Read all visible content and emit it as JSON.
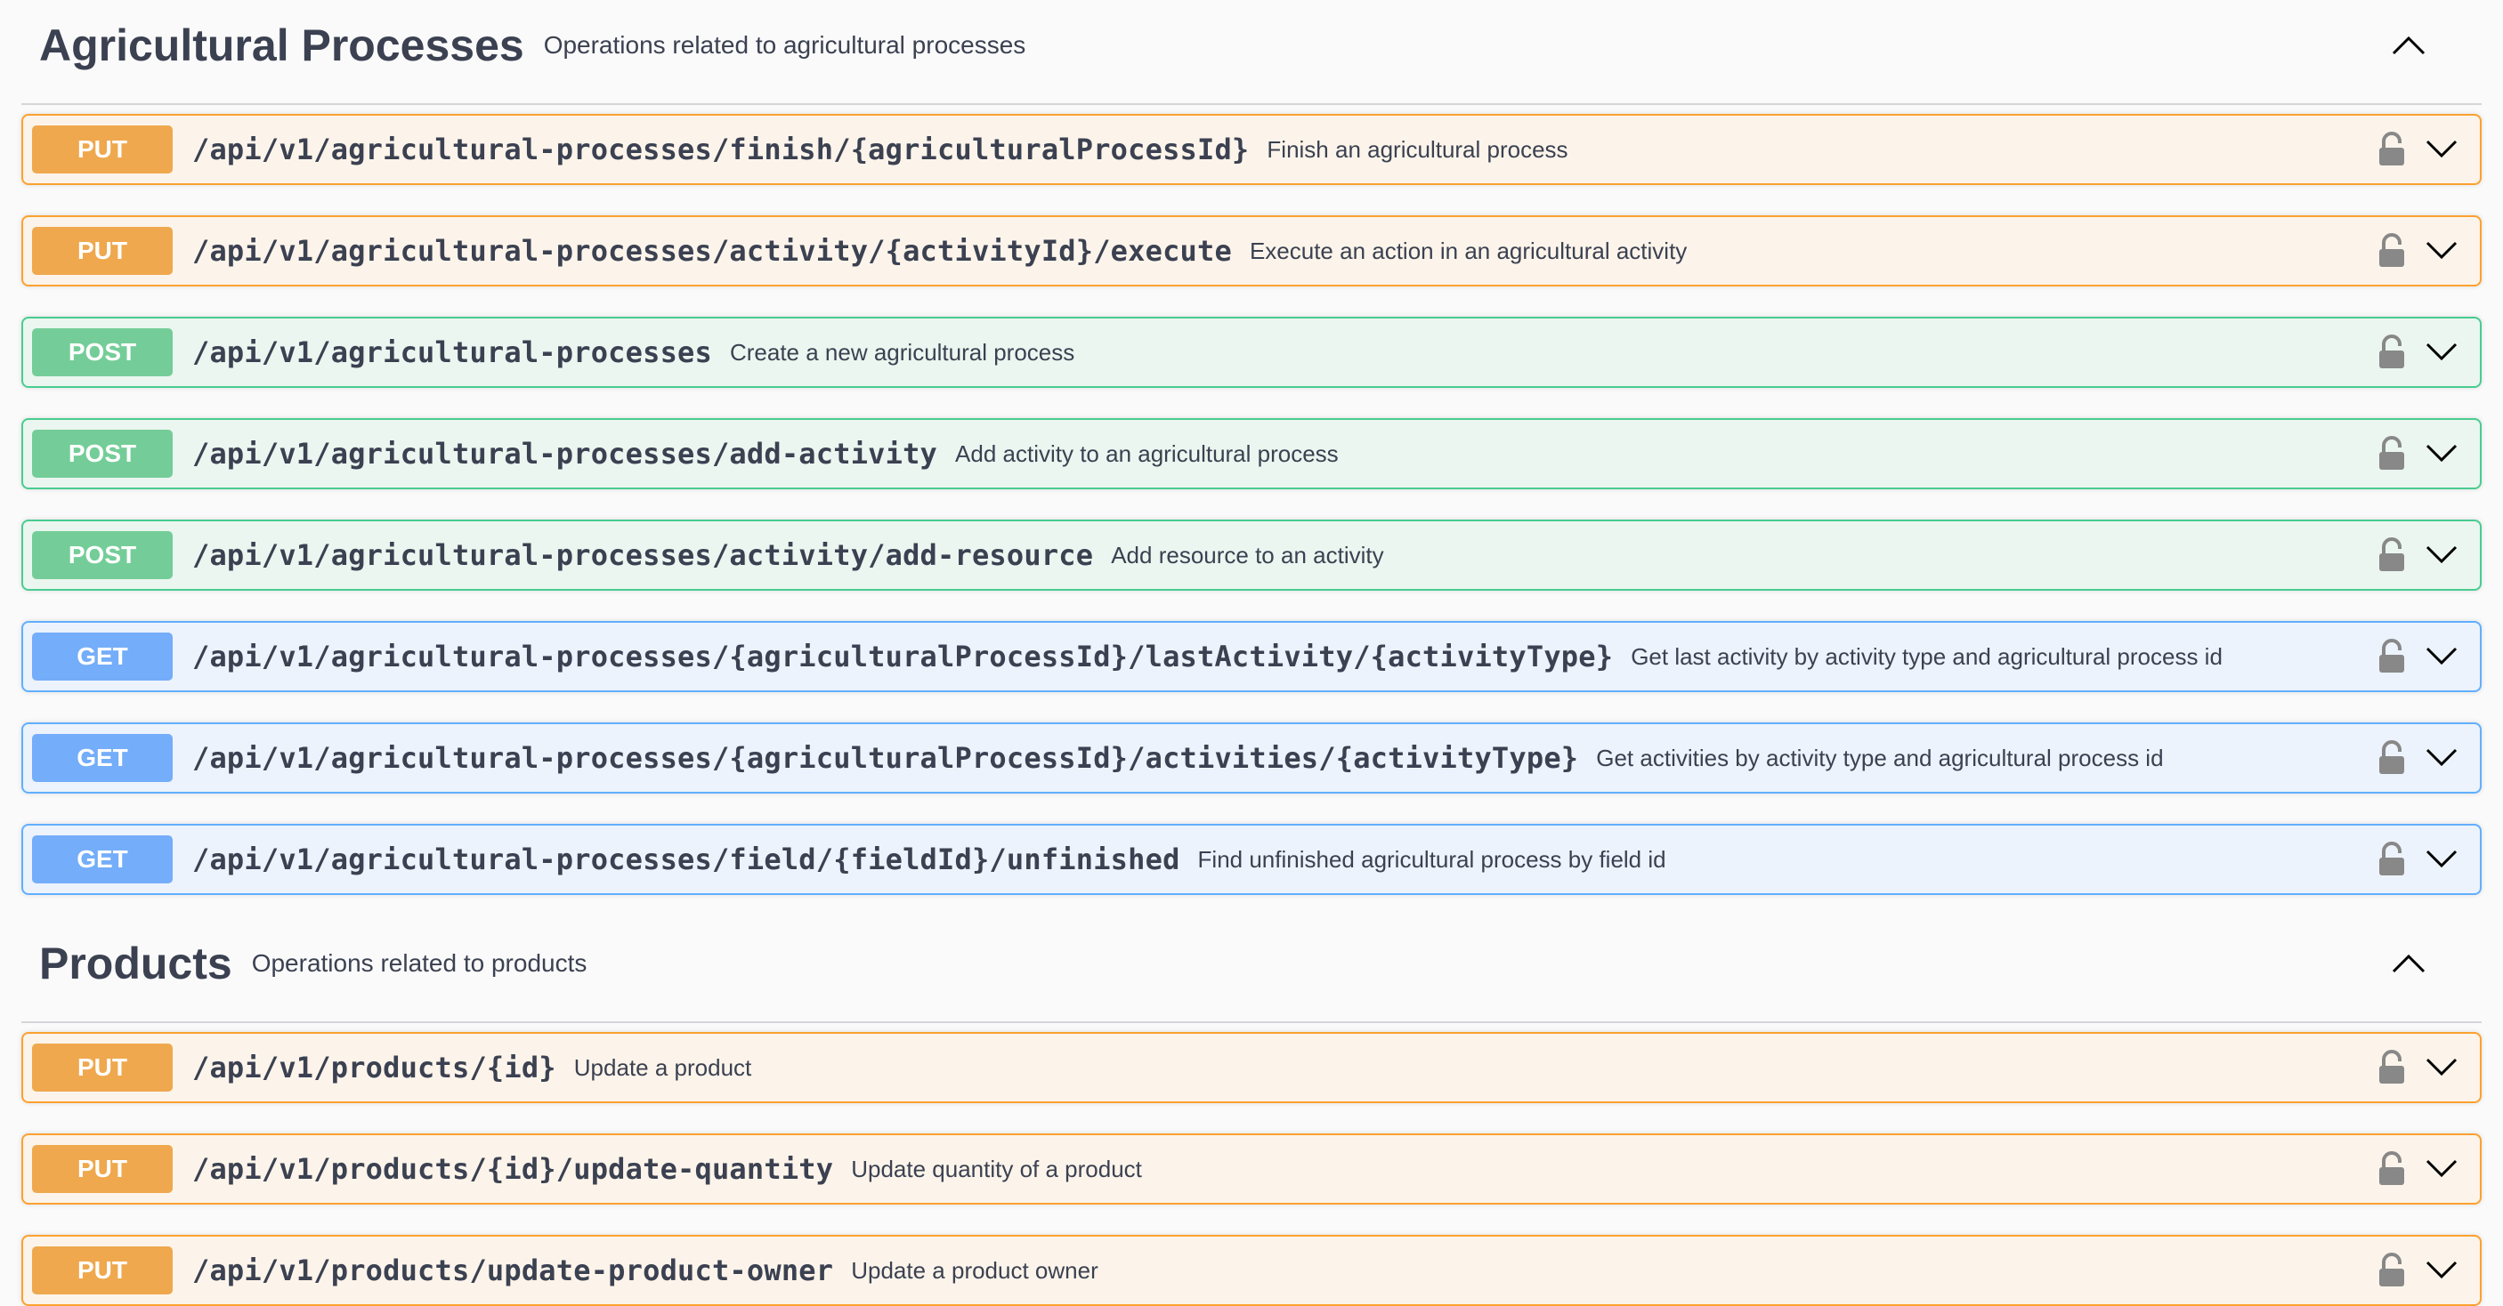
{
  "sections": [
    {
      "title": "Agricultural Processes",
      "description": "Operations related to agricultural processes",
      "operations": [
        {
          "method": "PUT",
          "path": "/api/v1/agricultural-processes/finish/{agriculturalProcessId}",
          "summary": "Finish an agricultural process"
        },
        {
          "method": "PUT",
          "path": "/api/v1/agricultural-processes/activity/{activityId}/execute",
          "summary": "Execute an action in an agricultural activity"
        },
        {
          "method": "POST",
          "path": "/api/v1/agricultural-processes",
          "summary": "Create a new agricultural process"
        },
        {
          "method": "POST",
          "path": "/api/v1/agricultural-processes/add-activity",
          "summary": "Add activity to an agricultural process"
        },
        {
          "method": "POST",
          "path": "/api/v1/agricultural-processes/activity/add-resource",
          "summary": "Add resource to an activity"
        },
        {
          "method": "GET",
          "path": "/api/v1/agricultural-processes/{agriculturalProcessId}/lastActivity/{activityType}",
          "summary": "Get last activity by activity type and agricultural process id"
        },
        {
          "method": "GET",
          "path": "/api/v1/agricultural-processes/{agriculturalProcessId}/activities/{activityType}",
          "summary": "Get activities by activity type and agricultural process id"
        },
        {
          "method": "GET",
          "path": "/api/v1/agricultural-processes/field/{fieldId}/unfinished",
          "summary": "Find unfinished agricultural process by field id"
        }
      ]
    },
    {
      "title": "Products",
      "description": "Operations related to products",
      "operations": [
        {
          "method": "PUT",
          "path": "/api/v1/products/{id}",
          "summary": "Update a product"
        },
        {
          "method": "PUT",
          "path": "/api/v1/products/{id}/update-quantity",
          "summary": "Update quantity of a product"
        },
        {
          "method": "PUT",
          "path": "/api/v1/products/update-product-owner",
          "summary": "Update a product owner"
        }
      ]
    }
  ],
  "icons": {
    "lock": "lock-open-icon",
    "expand": "chevron-down-icon",
    "collapse": "chevron-up-icon"
  },
  "colors": {
    "put_bg": "#fcf4ea",
    "put_border": "#fca130",
    "put_badge": "#efa84e",
    "post_bg": "#ebf6f0",
    "post_border": "#49cc90",
    "post_badge": "#74cd98",
    "get_bg": "#ecf3fc",
    "get_border": "#61affe",
    "get_badge": "#74adf9",
    "text": "#3b4151"
  }
}
